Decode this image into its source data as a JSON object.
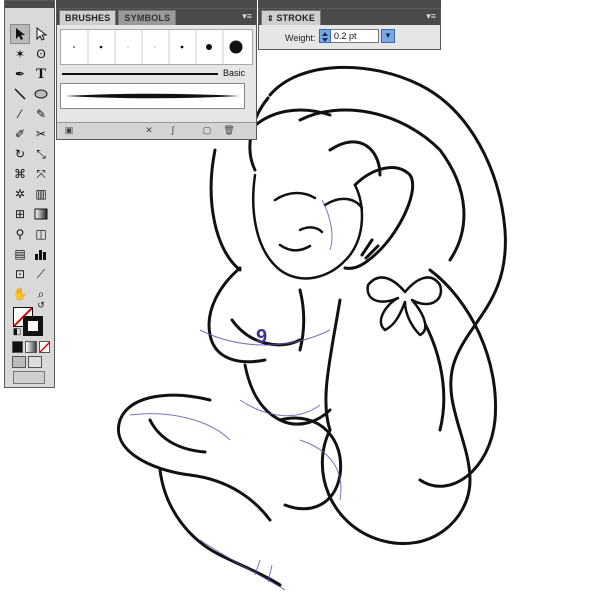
{
  "brushes_panel": {
    "tabs": [
      {
        "label": "BRUSHES"
      },
      {
        "label": "SYMBOLS"
      }
    ],
    "basic_label": "Basic"
  },
  "stroke_panel": {
    "title": "STROKE",
    "weight_label": "Weight:",
    "weight_value": "0.2 pt"
  },
  "artwork": {
    "jersey_number": "9"
  },
  "colors": {
    "panel_bg": "#e6e6e6",
    "panel_header": "#4a4a4a",
    "stepper_blue": "#7aa7e0",
    "sketch_purple": "#5b4fb0"
  },
  "icons": [
    "selection-tool-icon",
    "direct-selection-tool-icon",
    "magic-wand-icon",
    "lasso-icon",
    "pen-tool-icon",
    "type-tool-icon",
    "line-tool-icon",
    "ellipse-tool-icon",
    "paintbrush-icon",
    "pencil-icon",
    "blob-brush-icon",
    "scissors-icon",
    "rotate-icon",
    "scale-icon",
    "warp-icon",
    "free-transform-icon",
    "symbol-sprayer-icon",
    "graph-icon",
    "mesh-icon",
    "gradient-icon",
    "eyedropper-icon",
    "blend-icon",
    "live-paint-icon",
    "column-graph-icon",
    "artboard-icon",
    "slice-icon",
    "hand-icon",
    "zoom-icon",
    "fill-stroke-icon",
    "swap-icon",
    "default-colors-icon",
    "color-mode-icon",
    "draw-mode-icon",
    "screen-mode-icon"
  ]
}
